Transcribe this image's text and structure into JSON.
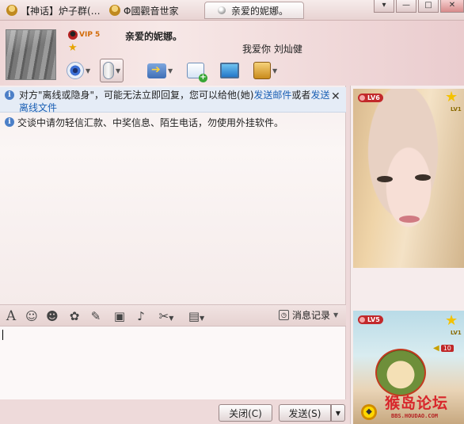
{
  "tabs": [
    {
      "label": "【神话】炉子群(…",
      "state": "inactive",
      "icon": "user-avatar-icon"
    },
    {
      "label": "Φ國觀音世家",
      "state": "inactive",
      "icon": "user-avatar-icon"
    },
    {
      "label": "亲爱的妮娜。",
      "state": "active",
      "icon": "status-dot-icon"
    }
  ],
  "window_controls": {
    "menu": "▾",
    "minimize": "—",
    "maximize": "□",
    "close": "✕"
  },
  "header": {
    "vip_label": "VIP 5",
    "contact_name": "亲爱的妮娜。",
    "signature": "我爱你 刘灿健",
    "toolbar": [
      {
        "name": "video-call",
        "icon": "camera-icon"
      },
      {
        "name": "voice-call",
        "icon": "microphone-icon"
      },
      {
        "name": "send-file",
        "icon": "folder-arrow-icon"
      },
      {
        "name": "create-discussion",
        "icon": "chat-add-icon"
      },
      {
        "name": "remote-assist",
        "icon": "screen-icon"
      },
      {
        "name": "apps",
        "icon": "app-box-icon"
      }
    ]
  },
  "chat": {
    "notice_part1": "对方\"离线或隐身\"，可能无法立即回复，您可以给他(她)",
    "notice_link1": "发送邮件",
    "notice_mid": "或者",
    "notice_link2": "发送离线文件",
    "warning": "交谈中请勿轻信汇款、中奖信息、陌生电话，勿使用外挂软件。"
  },
  "input_toolbar": {
    "icons": [
      "font-icon",
      "emoji-icon",
      "magic-face-icon",
      "shake-icon",
      "doodle-icon",
      "image-icon",
      "music-icon",
      "screenshot-icon",
      "briefcase-icon"
    ],
    "history_label": "消息记录"
  },
  "buttons": {
    "close_label": "关闭(C)",
    "send_label": "发送(S)"
  },
  "side_panel": {
    "top_level_badge": "LV6",
    "top_star_label": "LV1",
    "bottom_level_badge": "LV5",
    "bottom_star_label": "LV1",
    "speaker_count": "10",
    "forum_logo": "猴岛论坛",
    "forum_url": "BBS.HOUDAO.COM"
  },
  "colors": {
    "background": "#eed9da",
    "link": "#1a5fb4",
    "notice_bg": "#e5ecf6",
    "badge_red": "#c2292b"
  }
}
